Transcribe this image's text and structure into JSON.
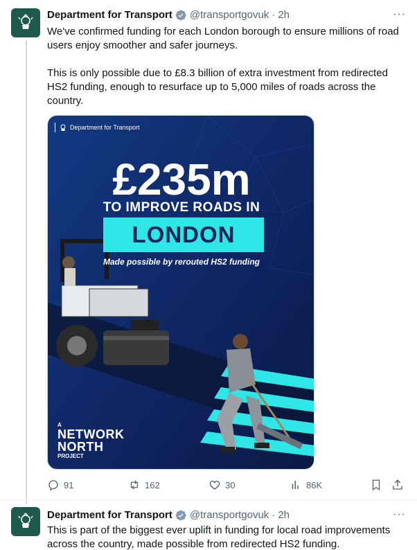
{
  "tweets": [
    {
      "author": "Department for Transport",
      "handle": "@transportgovuk",
      "separator": "·",
      "time": "2h",
      "more": "···",
      "text_p1": "We've confirmed funding for each London borough to ensure millions of road users enjoy smoother and safer journeys.",
      "text_p2": "This is only possible due to £8.3 billion of extra investment from redirected HS2 funding, enough to resurface up to 5,000 miles of roads across the country.",
      "media": {
        "brand": "Department for Transport",
        "amount": "£235m",
        "subtitle": "TO IMPROVE ROADS IN",
        "city": "LONDON",
        "tagline": "Made possible by rerouted HS2 funding",
        "logo_line1": "A",
        "logo_line2": "NETWORK",
        "logo_line3": "NORTH",
        "logo_line4": "PROJECT"
      },
      "actions": {
        "replies": "91",
        "retweets": "162",
        "likes": "30",
        "views": "86K"
      }
    },
    {
      "author": "Department for Transport",
      "handle": "@transportgovuk",
      "separator": "·",
      "time": "2h",
      "more": "···",
      "text_p1": "This is part of the biggest ever uplift in funding for local road improvements across the country, made possible from redirected HS2 funding."
    }
  ],
  "colors": {
    "text": "#0f1419",
    "muted": "#536471",
    "verified": "#829aab",
    "avatar_bg": "#1d5a4b",
    "card_navy": "#0f2460",
    "card_cyan": "#2ee6e6"
  },
  "icons": [
    "reply-icon",
    "retweet-icon",
    "like-icon",
    "views-icon",
    "bookmark-icon",
    "share-icon",
    "verified-badge-icon",
    "more-icon",
    "crest-icon"
  ]
}
